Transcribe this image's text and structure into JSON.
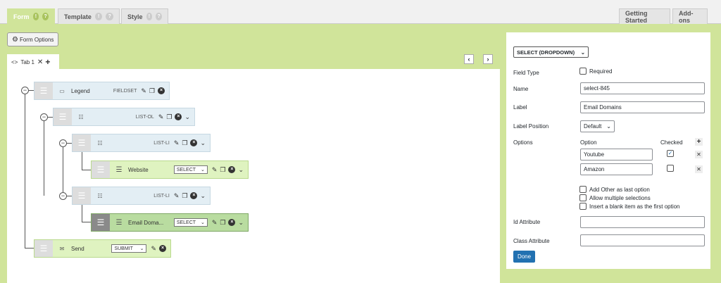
{
  "tabs": {
    "form": "Form",
    "template": "Template",
    "style": "Style",
    "getting_started": "Getting Started",
    "addons": "Add-ons",
    "badge1": "!",
    "badge2": "?"
  },
  "toolbar": {
    "form_options": "Form Options"
  },
  "canvas": {
    "tab_label": "Tab 1"
  },
  "tree": {
    "legend": {
      "label": "Legend",
      "type": "FIELDSET"
    },
    "list_ol": {
      "type": "LIST-OL"
    },
    "list_li_1": {
      "type": "LIST-LI"
    },
    "website": {
      "label": "Website",
      "select": "SELECT"
    },
    "list_li_2": {
      "type": "LIST-LI"
    },
    "email": {
      "label": "Email Doma...",
      "select": "SELECT"
    },
    "send": {
      "label": "Send",
      "select": "SUBMIT"
    }
  },
  "panel": {
    "field_type_select": "SELECT (DROPDOWN)",
    "field_type_label": "Field Type",
    "required_label": "Required",
    "name_label": "Name",
    "name_value": "select-845",
    "label_label": "Label",
    "label_value": "Email Domains",
    "label_position_label": "Label Position",
    "label_position_value": "Default",
    "options_label": "Options",
    "option_col": "Option",
    "checked_col": "Checked",
    "options": [
      {
        "value": "Youtube",
        "checked": true
      },
      {
        "value": "Amazon",
        "checked": false
      }
    ],
    "add_other": "Add Other as last option",
    "allow_multiple": "Allow multiple selections",
    "insert_blank": "Insert a blank item as the first option",
    "id_attr_label": "Id Attribute",
    "class_attr_label": "Class Attribute",
    "done": "Done"
  },
  "colors": {
    "accent_green": "#d0e49a",
    "primary_blue": "#2271b1"
  }
}
